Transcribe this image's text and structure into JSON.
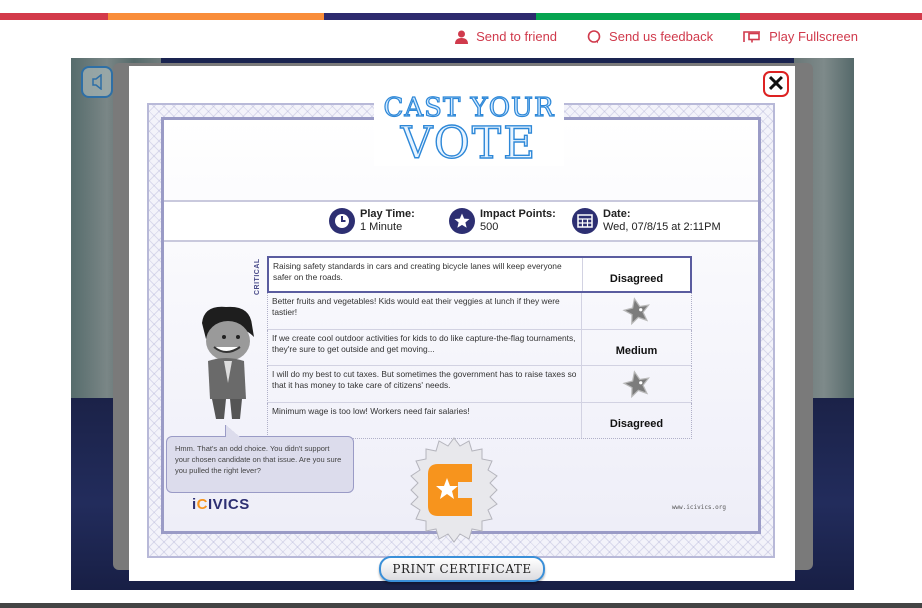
{
  "colors": {
    "bar": [
      "#d33a4a",
      "#f98d3a",
      "#2d2a6e",
      "#06a450",
      "#d33a4a"
    ],
    "link": "#d03a4c",
    "accent": "#2d2f72",
    "orange": "#f7941d"
  },
  "toplinks": [
    {
      "label": "Send to friend",
      "icon": "person-icon"
    },
    {
      "label": "Send us feedback",
      "icon": "speech-bubble-icon"
    },
    {
      "label": "Play Fullscreen",
      "icon": "fullscreen-icon"
    }
  ],
  "game": {
    "sound_icon": "speaker-icon",
    "close_icon": "close-icon",
    "certificate": {
      "title_line1": "CAST YOUR",
      "title_line2": "VOTE",
      "stats": [
        {
          "label": "Play Time:",
          "value": "1 Minute",
          "icon": "clock-icon"
        },
        {
          "label": "Impact Points:",
          "value": "500",
          "icon": "star-icon"
        },
        {
          "label": "Date:",
          "value": "Wed, 07/8/15 at 2:11PM",
          "icon": "calendar-icon"
        }
      ],
      "critical_label": "CRITICAL",
      "rows": [
        {
          "statement": "Raising safety standards in cars and creating bicycle lanes will keep everyone safer on the roads.",
          "result": "Disagreed",
          "critical": true
        },
        {
          "statement": "Better fruits and vegetables! Kids would eat their veggies at lunch if they were tastier!",
          "result": "",
          "star": true
        },
        {
          "statement": "If we create cool outdoor activities for kids to do like capture-the-flag tournaments, they're sure to get outside and get moving...",
          "result": "Medium"
        },
        {
          "statement": "I will do my best to cut taxes. But sometimes the government has to raise taxes so that it has money to take care of citizens' needs.",
          "result": "",
          "star": true
        },
        {
          "statement": "Minimum wage is too low! Workers need fair salaries!",
          "result": "Disagreed"
        }
      ],
      "bubble_text": "Hmm. That's an odd choice. You didn't support your chosen candidate on that issue. Are you sure you pulled the right lever?",
      "logo_prefix": "i",
      "logo_c": "C",
      "logo_suffix": "IVICS",
      "url": "www.icivics.org",
      "print_label": "PRINT CERTIFICATE"
    }
  }
}
